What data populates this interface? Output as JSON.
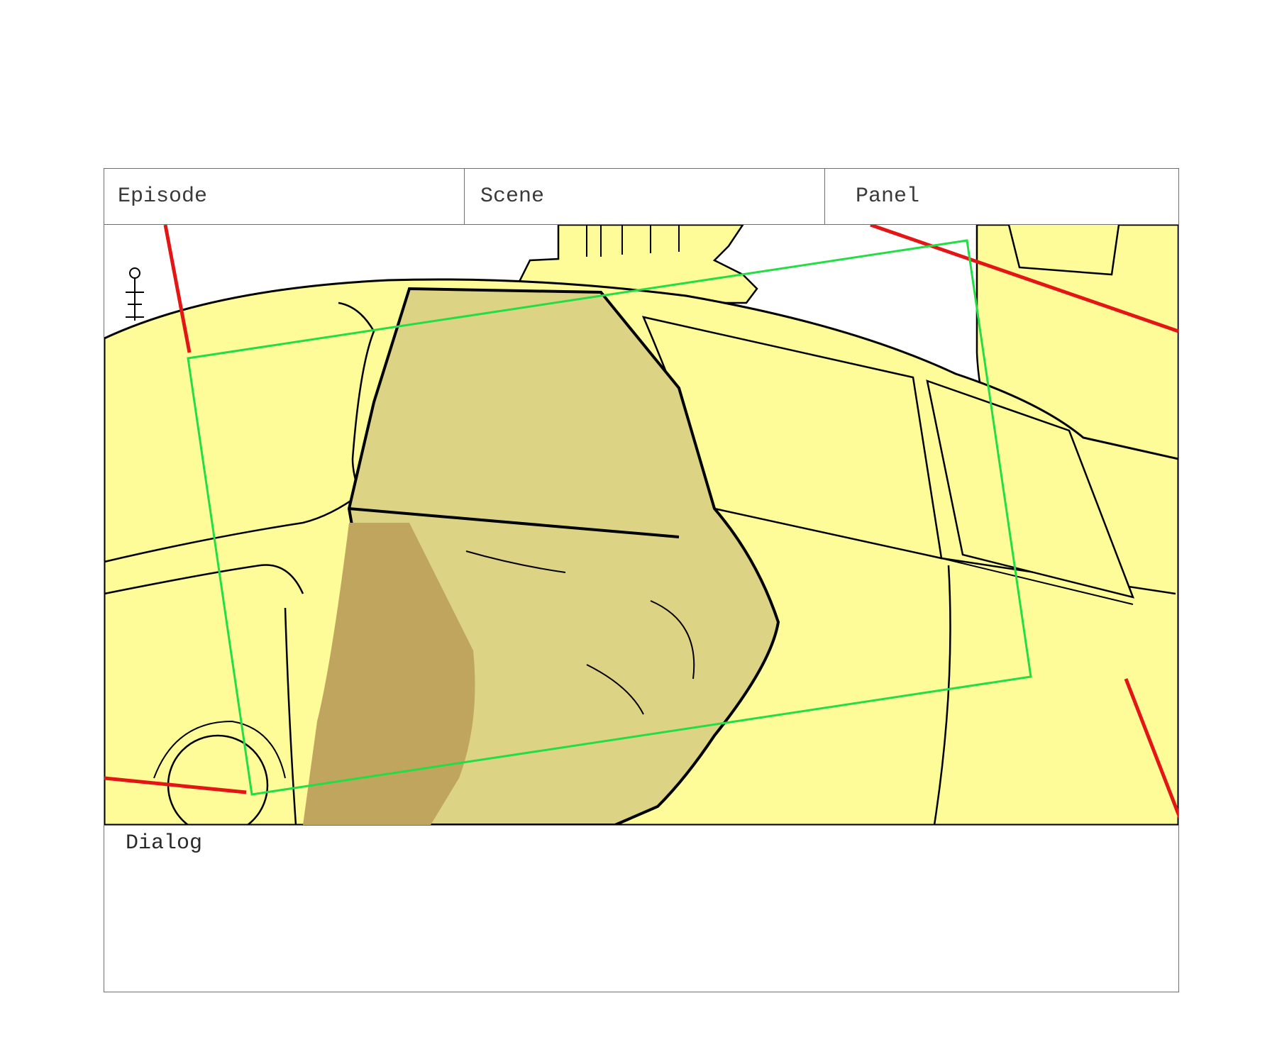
{
  "storyboard": {
    "episode_label": "Episode",
    "scene_label": "Scene",
    "panel_label": "Panel",
    "dialog_label": "Dialog"
  },
  "colors": {
    "vehicle_fill": "#fdfc98",
    "figure_fill": "#ddd384",
    "figure_shadow": "#c0a55f",
    "camera_frame": "#22dd44",
    "guide_lines": "#e31515",
    "ground_gray": "#aaaaaa",
    "ink": "#000000"
  }
}
